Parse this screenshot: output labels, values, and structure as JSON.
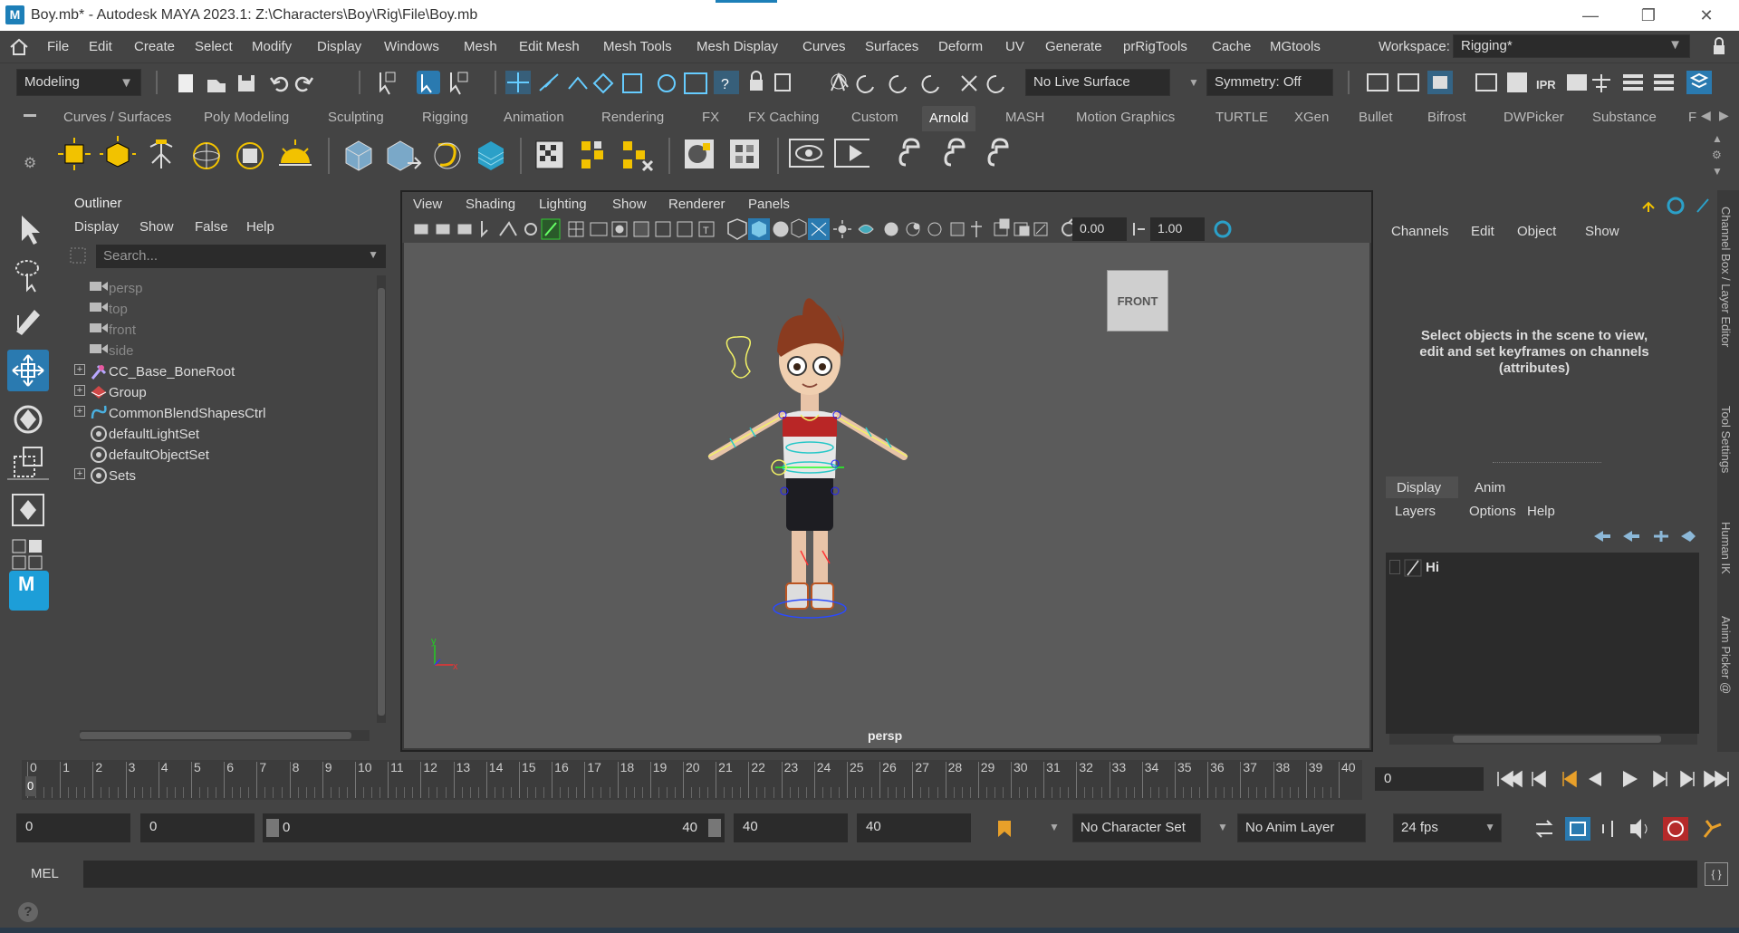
{
  "window": {
    "title": "Boy.mb* - Autodesk MAYA 2023.1: Z:\\Characters\\Boy\\Rig\\File\\Boy.mb",
    "logo": "M",
    "minimize": "—",
    "restore": "❐",
    "close": "✕"
  },
  "menubar": {
    "items": [
      "File",
      "Edit",
      "Create",
      "Select",
      "Modify",
      "Display",
      "Windows",
      "Mesh",
      "Edit Mesh",
      "Mesh Tools",
      "Mesh Display",
      "Curves",
      "Surfaces",
      "Deform",
      "UV",
      "Generate",
      "prRigTools",
      "Cache",
      "MGtools"
    ],
    "workspace_label": "Workspace:",
    "workspace_value": "Rigging*"
  },
  "statusline": {
    "mode": "Modeling",
    "live_surface": "No Live Surface",
    "symmetry": "Symmetry: Off"
  },
  "shelf": {
    "tabs": [
      "Curves / Surfaces",
      "Poly Modeling",
      "Sculpting",
      "Rigging",
      "Animation",
      "Rendering",
      "FX",
      "FX Caching",
      "Custom",
      "Arnold",
      "MASH",
      "Motion Graphics",
      "TURTLE",
      "XGen",
      "Bullet",
      "Bifrost",
      "DWPicker",
      "Substance",
      "F"
    ],
    "active_tab": "Arnold"
  },
  "outliner": {
    "title": "Outliner",
    "menu": [
      "Display",
      "Show",
      "False",
      "Help"
    ],
    "search_placeholder": "Search...",
    "items": [
      {
        "label": "persp",
        "type": "camera",
        "dim": true,
        "expand": false
      },
      {
        "label": "top",
        "type": "camera",
        "dim": true,
        "expand": false
      },
      {
        "label": "front",
        "type": "camera",
        "dim": true,
        "expand": false
      },
      {
        "label": "side",
        "type": "camera",
        "dim": true,
        "expand": false
      },
      {
        "label": "CC_Base_BoneRoot",
        "type": "joint",
        "dim": false,
        "expand": true
      },
      {
        "label": "Group",
        "type": "group",
        "dim": false,
        "expand": true
      },
      {
        "label": "CommonBlendShapesCtrl",
        "type": "curve",
        "dim": false,
        "expand": true
      },
      {
        "label": "defaultLightSet",
        "type": "set",
        "dim": false,
        "expand": false
      },
      {
        "label": "defaultObjectSet",
        "type": "set",
        "dim": false,
        "expand": false
      },
      {
        "label": "Sets",
        "type": "set",
        "dim": false,
        "expand": true
      }
    ]
  },
  "viewport": {
    "menu": [
      "View",
      "Shading",
      "Lighting",
      "Show",
      "Renderer",
      "Panels"
    ],
    "field_a": "0.00",
    "field_b": "1.00",
    "camera_label": "persp",
    "viewcube_label": "FRONT",
    "axis_y": "y",
    "axis_x": "x"
  },
  "channelbox": {
    "menu": [
      "Channels",
      "Edit",
      "Object",
      "Show"
    ],
    "hint": "Select objects in the scene to view, edit and set keyframes on channels (attributes)",
    "layer_tabs": [
      "Display",
      "Anim"
    ],
    "layer_menu": [
      "Layers",
      "Options",
      "Help"
    ],
    "layer_name": "Hi"
  },
  "side_tabs": [
    "Channel Box / Layer Editor",
    "Tool Settings",
    "Human IK",
    "Anim Picker @"
  ],
  "timeline": {
    "ticks": [
      "0",
      "1",
      "2",
      "3",
      "4",
      "5",
      "6",
      "7",
      "8",
      "9",
      "10",
      "11",
      "12",
      "13",
      "14",
      "15",
      "16",
      "17",
      "18",
      "19",
      "20",
      "21",
      "22",
      "23",
      "24",
      "25",
      "26",
      "27",
      "28",
      "29",
      "30",
      "31",
      "32",
      "33",
      "34",
      "35",
      "36",
      "37",
      "38",
      "39",
      "40"
    ],
    "current_frame": "0",
    "current_field": "0"
  },
  "range": {
    "start": "0",
    "anim_start": "0",
    "slider_start": "0",
    "slider_end": "40",
    "end": "40",
    "anim_end": "40",
    "character_set": "No Character Set",
    "anim_layer": "No Anim Layer",
    "fps": "24 fps"
  },
  "cmdline": {
    "language": "MEL"
  },
  "colors": {
    "panel": "#444444",
    "dark_field": "#2b2b2b",
    "viewport_bg": "#5b5b5b",
    "accent_blue": "#2a7ab0",
    "shelf_yellow": "#f2c200"
  }
}
